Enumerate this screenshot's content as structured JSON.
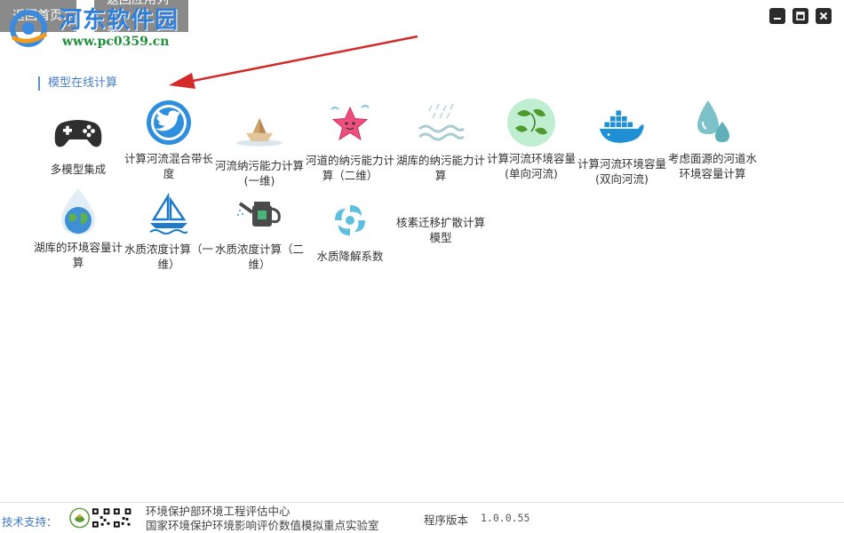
{
  "nav": {
    "back_home": "返回首页",
    "back_list": "返回应用列表"
  },
  "watermark": {
    "title": "河东软件园",
    "url": "www.pc0359.cn"
  },
  "window_controls": {
    "minimize_icon": "minimize-icon",
    "maximize_icon": "maximize-icon",
    "close_icon": "close-icon"
  },
  "section_title": "模型在线计算",
  "tiles": [
    {
      "label": "多模型集成",
      "icon": "gamepad-icon"
    },
    {
      "label": "计算河流混合带长度",
      "icon": "twitter-bird-icon"
    },
    {
      "label": "河流纳污能力计算(一维)",
      "icon": "paper-boat-icon"
    },
    {
      "label": "河道的纳污能力计算（二维）",
      "icon": "starfish-icon"
    },
    {
      "label": "湖库的纳污能力计算",
      "icon": "rain-waves-icon"
    },
    {
      "label": "计算河流环境容量(单向河流)",
      "icon": "leaves-recycle-icon"
    },
    {
      "label": "计算河流环境容量(双向河流)",
      "icon": "whale-containers-icon"
    },
    {
      "label": "考虑面源的河道水环境容量计算",
      "icon": "water-drops-icon"
    },
    {
      "label": "湖库的环境容量计算",
      "icon": "globe-drop-icon"
    },
    {
      "label": "水质浓度计算（一维）",
      "icon": "sailboat-icon"
    },
    {
      "label": "水质浓度计算（二维）",
      "icon": "watering-can-icon"
    },
    {
      "label": "水质降解系数",
      "icon": "swirl-icon"
    },
    {
      "label": "核素迁移扩散计算模型",
      "icon": "none"
    }
  ],
  "footer": {
    "tech_support": "技术支持：",
    "org_line1": "环境保护部环境工程评估中心",
    "org_line2": "国家环境保护环境影响评价数值模拟重点实验室",
    "version_label": "程序版本",
    "version_value": "1.0.0.55"
  },
  "colors": {
    "accent": "#4a7fc8",
    "nav_button": "#8a8a8a",
    "annotation_arrow": "#d42a2a"
  }
}
